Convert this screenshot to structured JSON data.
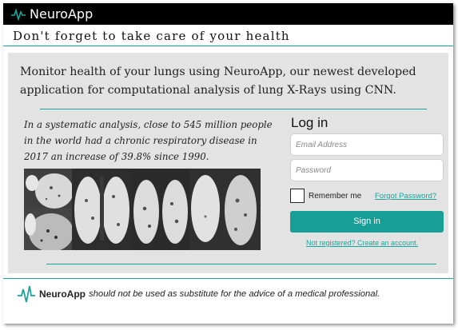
{
  "header": {
    "brand": "NeuroApp",
    "logo_icon": "heartbeat-icon"
  },
  "tagline": "Don't forget to take care of your health",
  "intro": "Monitor health of your lungs using NeuroApp, our newest developed application for computational analysis of lung X-Rays using CNN.",
  "stat_text": "In a systematic analysis, close to 545 million people in the world had a chronic respiratory disease in 2017 an increase of 39.8% since 1990.",
  "login": {
    "title": "Log in",
    "email_placeholder": "Email Address",
    "password_placeholder": "Password",
    "remember_label": "Remember me",
    "forgot_label": "Forgot Password?",
    "signin_label": "Sign in",
    "register_label": "Not registered? Create an account."
  },
  "footer": {
    "brand": "NeuroApp",
    "note": "should not be used as substitute for the advice of a medical professional."
  },
  "colors": {
    "accent": "#19a59d",
    "button": "#169e97",
    "topbar": "#000000",
    "panel": "#e3e3e3"
  }
}
